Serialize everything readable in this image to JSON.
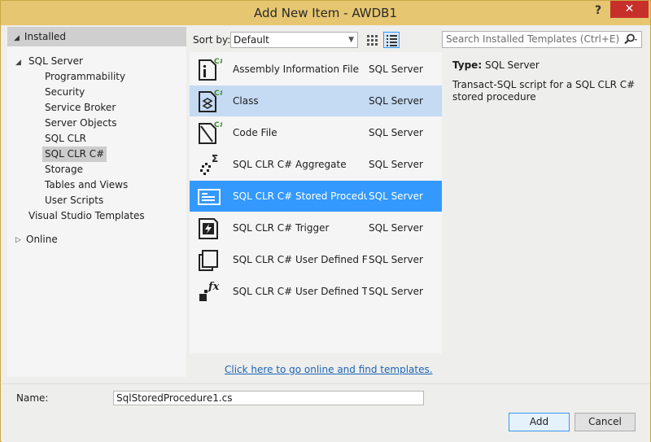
{
  "window": {
    "title": "Add New Item - AWDB1",
    "help_label": "?",
    "close_label": "✕"
  },
  "left_tree": {
    "header": "Installed",
    "root": "SQL Server",
    "children": [
      "Programmability",
      "Security",
      "Service Broker",
      "Server Objects",
      "SQL CLR",
      "SQL CLR C#",
      "Storage",
      "Tables and Views",
      "User Scripts"
    ],
    "selected_child": "SQL CLR C#",
    "vs_templates": "Visual Studio Templates",
    "online": "Online"
  },
  "toolbar": {
    "sort_label": "Sort by:",
    "sort_value": "Default",
    "view_modes": [
      "grid-view-icon",
      "list-view-icon"
    ],
    "active_view": "list-view-icon"
  },
  "search": {
    "placeholder": "Search Installed Templates (Ctrl+E)"
  },
  "templates": [
    {
      "name": "Assembly Information File",
      "category": "SQL Server",
      "icon": "assembly-info-cs-icon",
      "state": "normal"
    },
    {
      "name": "Class",
      "category": "SQL Server",
      "icon": "class-cs-icon",
      "state": "hover"
    },
    {
      "name": "Code File",
      "category": "SQL Server",
      "icon": "code-file-cs-icon",
      "state": "normal"
    },
    {
      "name": "SQL CLR C# Aggregate",
      "category": "SQL Server",
      "icon": "aggregate-icon",
      "state": "normal"
    },
    {
      "name": "SQL CLR C# Stored Procedure",
      "category": "SQL Server",
      "icon": "stored-procedure-icon",
      "state": "selected"
    },
    {
      "name": "SQL CLR C# Trigger",
      "category": "SQL Server",
      "icon": "trigger-icon",
      "state": "normal"
    },
    {
      "name": "SQL CLR C# User Defined Fun...",
      "category": "SQL Server",
      "icon": "user-defined-function-icon",
      "state": "normal"
    },
    {
      "name": "SQL CLR C# User Defined Type",
      "category": "SQL Server",
      "icon": "user-defined-type-icon",
      "state": "normal"
    }
  ],
  "details": {
    "type_label": "Type:",
    "type_value": "SQL Server",
    "description": "Transact-SQL script for a SQL CLR C# stored procedure"
  },
  "online_link": "Click here to go online and find templates.",
  "footer": {
    "name_label": "Name:",
    "name_value": "SqlStoredProcedure1.cs",
    "add_label": "Add",
    "cancel_label": "Cancel"
  },
  "colors": {
    "titlebar": "#e6c670",
    "close": "#c7302a",
    "selection": "#3399ff",
    "hover": "#c5daf3",
    "link": "#1b65b5"
  }
}
